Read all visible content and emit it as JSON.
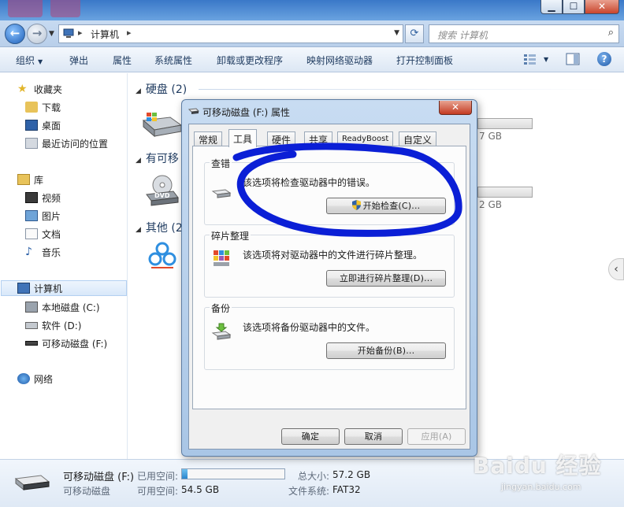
{
  "explorer": {
    "address": {
      "crumb": "计算机"
    },
    "search": {
      "placeholder": "搜索 计算机"
    },
    "window_buttons": {
      "min": "▁",
      "max": "☐",
      "close": "✕"
    },
    "toolbar": {
      "organize": "组织",
      "eject": "弹出",
      "properties": "属性",
      "system_properties": "系统属性",
      "uninstall": "卸载或更改程序",
      "map_drive": "映射网络驱动器",
      "control_panel": "打开控制面板",
      "help": "?"
    },
    "nav": {
      "favorites": "收藏夹",
      "downloads": "下载",
      "desktop": "桌面",
      "recent": "最近访问的位置",
      "libraries": "库",
      "videos": "视频",
      "pictures": "图片",
      "documents": "文档",
      "music": "音乐",
      "computer": "计算机",
      "local_disk": "本地磁盘 (C:)",
      "software": "软件 (D:)",
      "removable": "可移动磁盘 (F:)",
      "network": "网络"
    },
    "groups": {
      "hard_disks": "硬盘 (2)",
      "removable_partial": "有可移",
      "other_partial": "其他 (2",
      "drive1_free": "7 GB",
      "drive2_free": "2 GB"
    },
    "details": {
      "name": "可移动磁盘 (F:)",
      "type": "可移动磁盘",
      "used_label": "已用空间:",
      "free_label": "可用空间:",
      "free_value": "54.5 GB",
      "total_label": "总大小:",
      "total_value": "57.2 GB",
      "fs_label": "文件系统:",
      "fs_value": "FAT32",
      "used_fraction": 0.05
    }
  },
  "dialog": {
    "title": "可移动磁盘 (F:) 属性",
    "close": "✕",
    "tabs": [
      "常规",
      "工具",
      "硬件",
      "共享",
      "ReadyBoost",
      "自定义"
    ],
    "active_tab": "工具",
    "error_check": {
      "title": "查错",
      "desc": "该选项将检查驱动器中的错误。",
      "button": "开始检查(C)..."
    },
    "defrag": {
      "title": "碎片整理",
      "desc": "该选项将对驱动器中的文件进行碎片整理。",
      "button": "立即进行碎片整理(D)..."
    },
    "backup": {
      "title": "备份",
      "desc": "该选项将备份驱动器中的文件。",
      "button": "开始备份(B)..."
    },
    "ok": "确定",
    "cancel": "取消",
    "apply": "应用(A)"
  },
  "watermark": {
    "main": "Baidu 经验",
    "sub": "jingyan.baidu.com"
  },
  "colors": {
    "title_bar": "#3a78c8",
    "annotation": "#0b1fd6",
    "usage_fill": "#2a86cc"
  }
}
